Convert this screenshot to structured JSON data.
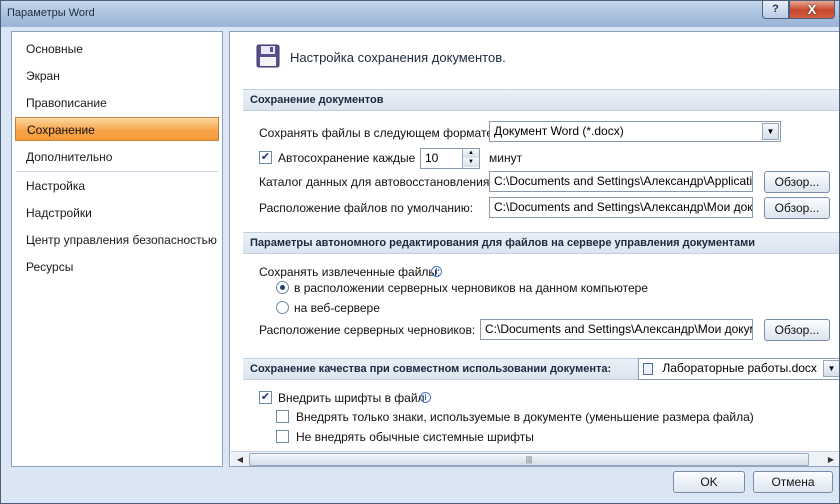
{
  "window": {
    "title": "Параметры Word",
    "help": "?",
    "close": "X"
  },
  "nav": {
    "items": [
      {
        "label": "Основные"
      },
      {
        "label": "Экран"
      },
      {
        "label": "Правописание"
      },
      {
        "label": "Сохранение"
      },
      {
        "label": "Дополнительно"
      },
      {
        "label": "Настройка"
      },
      {
        "label": "Надстройки"
      },
      {
        "label": "Центр управления безопасностью"
      },
      {
        "label": "Ресурсы"
      }
    ],
    "selected": "Сохранение"
  },
  "header": {
    "title": "Настройка сохранения документов.",
    "icon": "floppy-disk-icon"
  },
  "save_docs": {
    "section_title": "Сохранение документов",
    "format_label": "Сохранять файлы в следующем формате:",
    "format_value": "Документ Word (*.docx)",
    "autosave_label": "Автосохранение каждые",
    "autosave_checked": true,
    "autosave_value": "10",
    "autosave_unit": "минут",
    "autorecover_label": "Каталог данных для автовосстановления:",
    "autorecover_path": "C:\\Documents and Settings\\Александр\\Application",
    "default_label": "Расположение файлов по умолчанию:",
    "default_path": "C:\\Documents and Settings\\Александр\\Мои докум",
    "browse": "Обзор..."
  },
  "offline": {
    "section_title": "Параметры автономного редактирования для файлов на сервере управления документами",
    "save_checked_label": "Сохранять извлеченные файлы:",
    "option_local": "в расположении серверных черновиков на данном компьютере",
    "option_web": "на веб-сервере",
    "selected_option": "local",
    "drafts_label": "Расположение серверных черновиков:",
    "drafts_path": "C:\\Documents and Settings\\Александр\\Мои докуме",
    "browse": "Обзор..."
  },
  "fidelity": {
    "section_title": "Сохранение качества при совместном использовании документа:",
    "document": "Лабораторные работы.docx",
    "embed_fonts_label": "Внедрить шрифты в файл",
    "embed_fonts_checked": true,
    "embed_used_label": "Внедрять только знаки, используемые в документе (уменьшение размера файла)",
    "embed_used_checked": false,
    "no_system_label": "Не внедрять обычные системные шрифты",
    "no_system_checked": false
  },
  "footer": {
    "ok": "OK",
    "cancel": "Отмена"
  }
}
